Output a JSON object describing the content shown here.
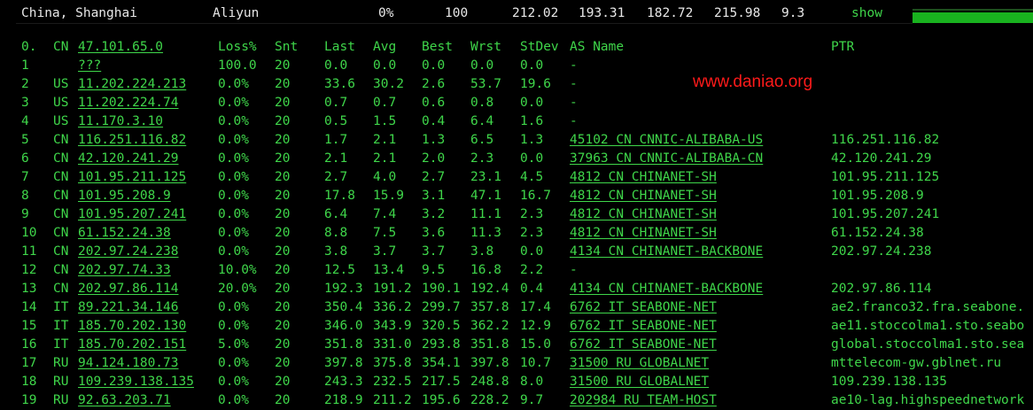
{
  "header": {
    "location": "China, Shanghai",
    "provider": "Aliyun",
    "loss": "0%",
    "sent": "100",
    "last": "212.02",
    "avg": "193.31",
    "best": "182.72",
    "worst": "215.98",
    "stdev": "9.3",
    "show_label": "show",
    "bar_fraction": 1.0
  },
  "columns": {
    "hop": "0.",
    "cc": "CN",
    "ip": "47.101.65.0",
    "loss": "Loss%",
    "snt": "Snt",
    "last": "Last",
    "avg": "Avg",
    "best": "Best",
    "wrst": "Wrst",
    "stdev": "StDev",
    "as": "AS Name",
    "ptr": "PTR"
  },
  "watermark": "www.daniao.org",
  "rows": [
    {
      "hop": "1",
      "cc": "",
      "ip": "???",
      "loss": "100.0",
      "snt": "20",
      "last": "0.0",
      "avg": "0.0",
      "best": "0.0",
      "wrst": "0.0",
      "stdev": "0.0",
      "as": "-",
      "ptr": ""
    },
    {
      "hop": "2",
      "cc": "US",
      "ip": "11.202.224.213",
      "loss": "0.0%",
      "snt": "20",
      "last": "33.6",
      "avg": "30.2",
      "best": "2.6",
      "wrst": "53.7",
      "stdev": "19.6",
      "as": "-",
      "ptr": ""
    },
    {
      "hop": "3",
      "cc": "US",
      "ip": "11.202.224.74",
      "loss": "0.0%",
      "snt": "20",
      "last": "0.7",
      "avg": "0.7",
      "best": "0.6",
      "wrst": "0.8",
      "stdev": "0.0",
      "as": "-",
      "ptr": ""
    },
    {
      "hop": "4",
      "cc": "US",
      "ip": "11.170.3.10",
      "loss": "0.0%",
      "snt": "20",
      "last": "0.5",
      "avg": "1.5",
      "best": "0.4",
      "wrst": "6.4",
      "stdev": "1.6",
      "as": "-",
      "ptr": ""
    },
    {
      "hop": "5",
      "cc": "CN",
      "ip": "116.251.116.82",
      "loss": "0.0%",
      "snt": "20",
      "last": "1.7",
      "avg": "2.1",
      "best": "1.3",
      "wrst": "6.5",
      "stdev": "1.3",
      "as": "45102 CN CNNIC-ALIBABA-US",
      "ptr": "116.251.116.82"
    },
    {
      "hop": "6",
      "cc": "CN",
      "ip": "42.120.241.29",
      "loss": "0.0%",
      "snt": "20",
      "last": "2.1",
      "avg": "2.1",
      "best": "2.0",
      "wrst": "2.3",
      "stdev": "0.0",
      "as": "37963 CN CNNIC-ALIBABA-CN",
      "ptr": "42.120.241.29"
    },
    {
      "hop": "7",
      "cc": "CN",
      "ip": "101.95.211.125",
      "loss": "0.0%",
      "snt": "20",
      "last": "2.7",
      "avg": "4.0",
      "best": "2.7",
      "wrst": "23.1",
      "stdev": "4.5",
      "as": "4812  CN CHINANET-SH",
      "ptr": "101.95.211.125"
    },
    {
      "hop": "8",
      "cc": "CN",
      "ip": "101.95.208.9",
      "loss": "0.0%",
      "snt": "20",
      "last": "17.8",
      "avg": "15.9",
      "best": "3.1",
      "wrst": "47.1",
      "stdev": "16.7",
      "as": "4812  CN CHINANET-SH",
      "ptr": "101.95.208.9"
    },
    {
      "hop": "9",
      "cc": "CN",
      "ip": "101.95.207.241",
      "loss": "0.0%",
      "snt": "20",
      "last": "6.4",
      "avg": "7.4",
      "best": "3.2",
      "wrst": "11.1",
      "stdev": "2.3",
      "as": "4812  CN CHINANET-SH",
      "ptr": "101.95.207.241"
    },
    {
      "hop": "10",
      "cc": "CN",
      "ip": "61.152.24.38",
      "loss": "0.0%",
      "snt": "20",
      "last": "8.8",
      "avg": "7.5",
      "best": "3.6",
      "wrst": "11.3",
      "stdev": "2.3",
      "as": "4812  CN CHINANET-SH",
      "ptr": "61.152.24.38"
    },
    {
      "hop": "11",
      "cc": "CN",
      "ip": "202.97.24.238",
      "loss": "0.0%",
      "snt": "20",
      "last": "3.8",
      "avg": "3.7",
      "best": "3.7",
      "wrst": "3.8",
      "stdev": "0.0",
      "as": "4134  CN CHINANET-BACKBONE",
      "ptr": "202.97.24.238"
    },
    {
      "hop": "12",
      "cc": "CN",
      "ip": "202.97.74.33",
      "loss": "10.0%",
      "snt": "20",
      "last": "12.5",
      "avg": "13.4",
      "best": "9.5",
      "wrst": "16.8",
      "stdev": "2.2",
      "as": "-",
      "ptr": ""
    },
    {
      "hop": "13",
      "cc": "CN",
      "ip": "202.97.86.114",
      "loss": "20.0%",
      "snt": "20",
      "last": "192.3",
      "avg": "191.2",
      "best": "190.1",
      "wrst": "192.4",
      "stdev": "0.4",
      "as": "4134  CN CHINANET-BACKBONE",
      "ptr": "202.97.86.114"
    },
    {
      "hop": "14",
      "cc": "IT",
      "ip": "89.221.34.146",
      "loss": "0.0%",
      "snt": "20",
      "last": "350.4",
      "avg": "336.2",
      "best": "299.7",
      "wrst": "357.8",
      "stdev": "17.4",
      "as": "6762  IT SEABONE-NET",
      "ptr": "ae2.franco32.fra.seabone."
    },
    {
      "hop": "15",
      "cc": "IT",
      "ip": "185.70.202.130",
      "loss": "0.0%",
      "snt": "20",
      "last": "346.0",
      "avg": "343.9",
      "best": "320.5",
      "wrst": "362.2",
      "stdev": "12.9",
      "as": "6762  IT SEABONE-NET",
      "ptr": "ae11.stoccolma1.sto.seabo"
    },
    {
      "hop": "16",
      "cc": "IT",
      "ip": "185.70.202.151",
      "loss": "5.0%",
      "snt": "20",
      "last": "351.8",
      "avg": "331.0",
      "best": "293.8",
      "wrst": "351.8",
      "stdev": "15.0",
      "as": "6762  IT SEABONE-NET",
      "ptr": "global.stoccolma1.sto.sea"
    },
    {
      "hop": "17",
      "cc": "RU",
      "ip": "94.124.180.73",
      "loss": "0.0%",
      "snt": "20",
      "last": "397.8",
      "avg": "375.8",
      "best": "354.1",
      "wrst": "397.8",
      "stdev": "10.7",
      "as": "31500 RU GLOBALNET",
      "ptr": "mttelecom-gw.gblnet.ru"
    },
    {
      "hop": "18",
      "cc": "RU",
      "ip": "109.239.138.135",
      "loss": "0.0%",
      "snt": "20",
      "last": "243.3",
      "avg": "232.5",
      "best": "217.5",
      "wrst": "248.8",
      "stdev": "8.0",
      "as": "31500 RU GLOBALNET",
      "ptr": "109.239.138.135"
    },
    {
      "hop": "19",
      "cc": "RU",
      "ip": "92.63.203.71",
      "loss": "0.0%",
      "snt": "20",
      "last": "218.9",
      "avg": "211.2",
      "best": "195.6",
      "wrst": "228.2",
      "stdev": "9.7",
      "as": "202984 RU TEAM-HOST",
      "ptr": "ae10-lag.highspeednetwork"
    }
  ]
}
